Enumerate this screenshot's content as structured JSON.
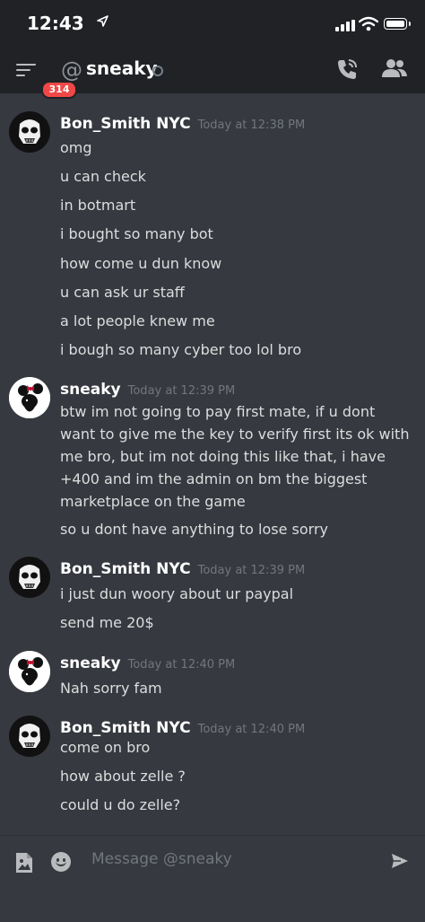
{
  "status_bar": {
    "time": "12:43"
  },
  "header": {
    "badge": "314",
    "at": "@",
    "title": "sneaky"
  },
  "messages": [
    {
      "author": "Bon_Smith NYC",
      "timestamp": "Today at 12:38 PM",
      "avatar": "stormtrooper",
      "lines": [
        "omg",
        "u can check",
        "in botmart",
        "i bought so many bot",
        "how come u dun know",
        "u can ask ur staff",
        "a lot people knew me",
        "i bough so many cyber too lol bro"
      ]
    },
    {
      "author": "sneaky",
      "timestamp": "Today at 12:39 PM",
      "avatar": "minnie",
      "lines": [
        "btw im not going to pay first mate, if u dont want to give me the key to verify first its ok with me bro, but im not doing this like that, i have +400 and im the admin on bm the biggest marketplace on the game",
        "so u dont have anything to lose sorry"
      ]
    },
    {
      "author": "Bon_Smith NYC",
      "timestamp": "Today at 12:39 PM",
      "avatar": "stormtrooper",
      "lines": [
        "i just dun woory about ur paypal",
        "send me 20$"
      ]
    },
    {
      "author": "sneaky",
      "timestamp": "Today at 12:40 PM",
      "avatar": "minnie",
      "lines": [
        "Nah sorry fam"
      ]
    },
    {
      "author": "Bon_Smith NYC",
      "timestamp": "Today at 12:40 PM",
      "avatar": "stormtrooper",
      "lines": [
        "come on bro",
        "how about zelle ?",
        "could u do zelle?"
      ]
    }
  ],
  "composer": {
    "placeholder": "Message @sneaky"
  },
  "colors": {
    "background": "#36393f",
    "header": "#202225",
    "badge": "#f04747",
    "timestamp": "#72767d"
  }
}
